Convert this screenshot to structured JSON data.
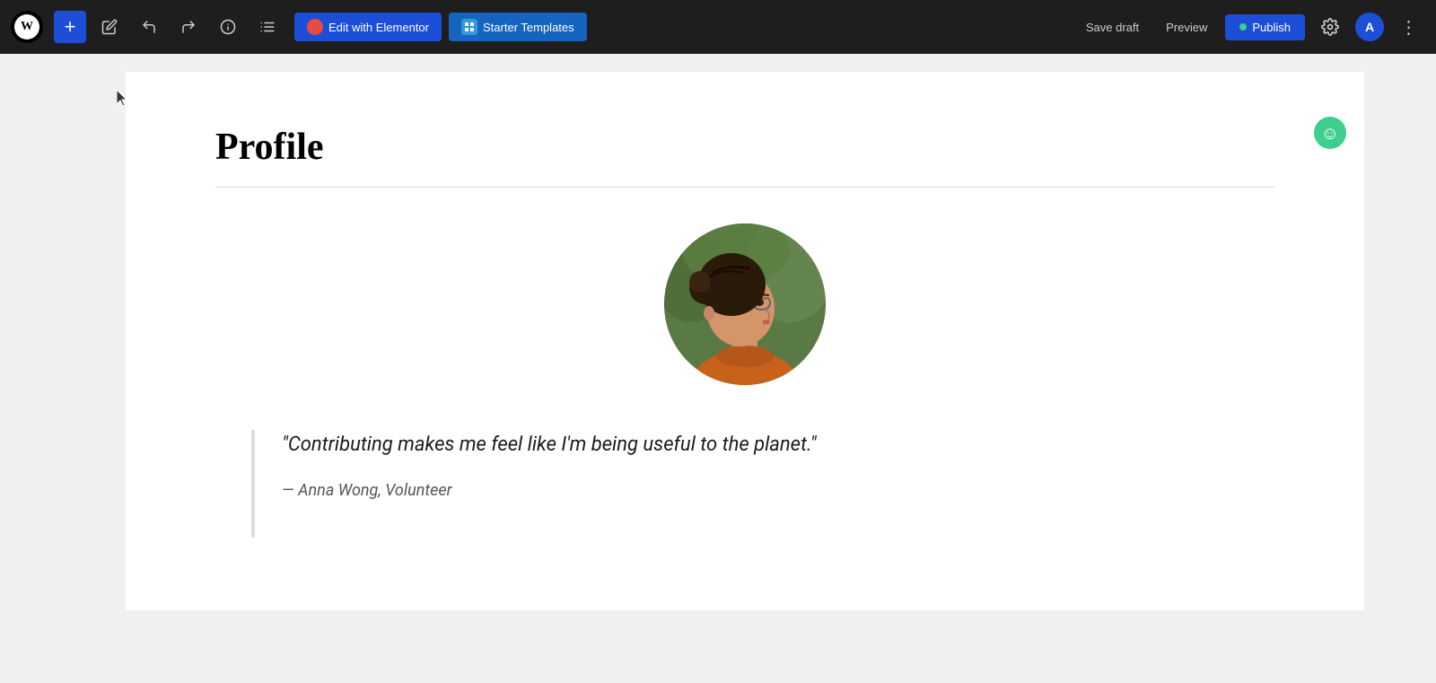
{
  "toolbar": {
    "add_label": "+",
    "edit_with_elementor_label": "Edit with Elementor",
    "starter_templates_label": "Starter Templates",
    "save_draft_label": "Save draft",
    "preview_label": "Preview",
    "publish_label": "Publish",
    "user_initial": "A",
    "more_label": "⋮"
  },
  "page": {
    "title": "Profile",
    "quote": "\"Contributing makes me feel like I'm being useful to the planet.\"",
    "attribution": "— Anna Wong, Volunteer"
  },
  "colors": {
    "accent_blue": "#1d4ed8",
    "green": "#3ecf8e",
    "publish_blue": "#1d4ed8"
  }
}
